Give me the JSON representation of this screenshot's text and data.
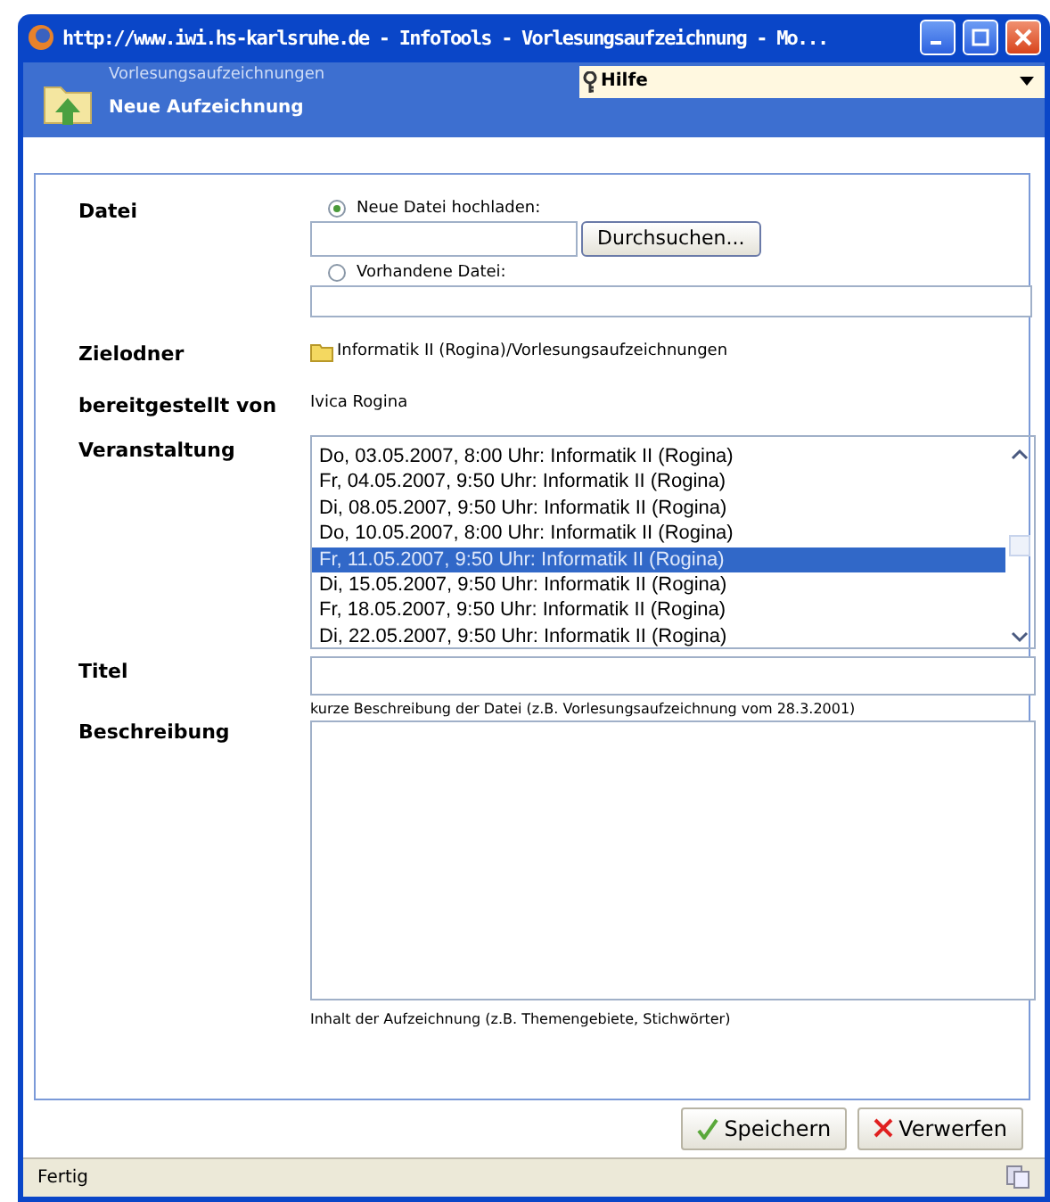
{
  "window": {
    "title": "http://www.iwi.hs-karlsruhe.de - InfoTools - Vorlesungsaufzeichnung - Mo..."
  },
  "header": {
    "breadcrumb": "Vorlesungsaufzeichnungen",
    "heading": "Neue Aufzeichnung",
    "help": "Hilfe"
  },
  "form": {
    "file": {
      "label": "Datei",
      "options": [
        {
          "label": "Neue Datei hochladen:",
          "selected": true,
          "kind": "upload"
        },
        {
          "label": "Vorhandene Datei:",
          "selected": false,
          "kind": "text"
        }
      ],
      "browse_button": "Durchsuchen..."
    },
    "target_folder": {
      "label": "Zielodner",
      "value": "Informatik II (Rogina)/Vorlesungsaufzeichnungen"
    },
    "provided_by": {
      "label": "bereitgestellt von",
      "value": "Ivica Rogina"
    },
    "event": {
      "label": "Veranstaltung",
      "items": [
        {
          "label": "Do, 03.05.2007, 8:00 Uhr: Informatik II (Rogina)",
          "selected": false
        },
        {
          "label": "Fr, 04.05.2007, 9:50 Uhr: Informatik II (Rogina)",
          "selected": false
        },
        {
          "label": "Di, 08.05.2007, 9:50 Uhr: Informatik II (Rogina)",
          "selected": false
        },
        {
          "label": "Do, 10.05.2007, 8:00 Uhr: Informatik II (Rogina)",
          "selected": false
        },
        {
          "label": "Fr, 11.05.2007, 9:50 Uhr: Informatik II (Rogina)",
          "selected": true
        },
        {
          "label": "Di, 15.05.2007, 9:50 Uhr: Informatik II (Rogina)",
          "selected": false
        },
        {
          "label": "Fr, 18.05.2007, 9:50 Uhr: Informatik II (Rogina)",
          "selected": false
        },
        {
          "label": "Di, 22.05.2007, 9:50 Uhr: Informatik II (Rogina)",
          "selected": false
        }
      ]
    },
    "title": {
      "label": "Titel",
      "hint": "kurze Beschreibung der Datei (z.B. Vorlesungsaufzeichnung vom 28.3.2001)"
    },
    "description": {
      "label": "Beschreibung",
      "hint": "Inhalt der Aufzeichnung (z.B. Themengebiete, Stichwörter)"
    }
  },
  "buttons": [
    {
      "label": "Speichern",
      "kind": "save"
    },
    {
      "label": "Verwerfen",
      "kind": "discard"
    }
  ],
  "status_bar": {
    "text": "Fertig"
  }
}
